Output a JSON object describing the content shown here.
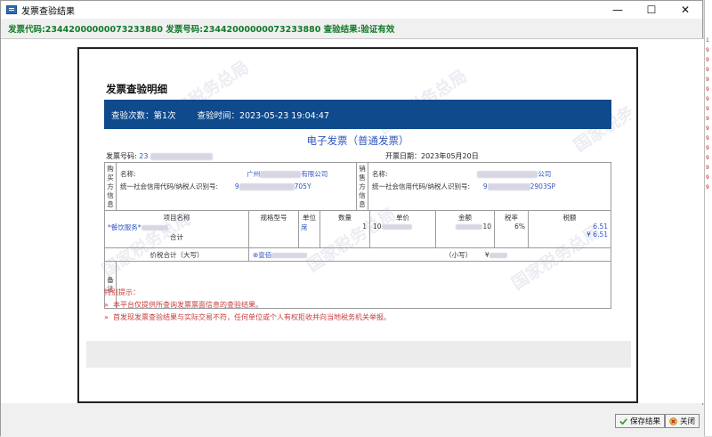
{
  "window": {
    "title": "发票查验结果",
    "minimize": "—",
    "maximize": "☐",
    "close": "✕"
  },
  "status_line": "发票代码:23442000000073233880 发票号码:23442000000073233880 查验结果:验证有效",
  "doc": {
    "heading": "发票查验明细",
    "check_count": "查验次数：第1次",
    "check_time": "查验时间：2023-05-23 19:04:47",
    "invoice_title": "电子发票（普通发票）",
    "invoice_no_label": "发票号码:",
    "invoice_no_value": "23",
    "issue_date": "开票日期：2023年05月20日",
    "buyer": {
      "v_label": [
        "购",
        "买",
        "方",
        "信",
        "息"
      ],
      "name_label": "名称:",
      "name_value": "广州",
      "name_suffix": "有限公司",
      "id_label": "统一社会信用代码/纳税人识别号:",
      "id_prefix": "9",
      "id_suffix": "705Y"
    },
    "seller": {
      "v_label": [
        "销",
        "售",
        "方",
        "信",
        "息"
      ],
      "name_label": "名称:",
      "name_suffix": "公司",
      "id_label": "统一社会信用代码/纳税人识别号:",
      "id_prefix": "9",
      "id_suffix": "2903SP"
    },
    "items_head": {
      "name": "项目名称",
      "spec": "规格型号",
      "unit": "单位",
      "qty": "数量",
      "price": "单价",
      "amount": "金额",
      "rate": "税率",
      "tax": "税额"
    },
    "item": {
      "name": "*餐饮服务*",
      "unit": "席",
      "qty": "1",
      "price": "10",
      "amount_suffix": "10",
      "rate": "6%",
      "tax": "6.51"
    },
    "subtotal_label": "合计",
    "subtotal_tax": "¥ 6.51",
    "total_label": "价税合计（大写）",
    "total_upper_prefix": "⊗壹佰",
    "total_small_label": "（小写）",
    "total_small_value": "¥",
    "remarks_label": [
      "备",
      "注"
    ]
  },
  "notice": {
    "title": "特别提示：",
    "items": [
      "本平台仅提供所查询发票票面信息的查验结果。",
      "首发现发票查验结果与实际交易不符，任何单位或个人有权拒收并向当地税务机关举报。"
    ]
  },
  "watermark": "国家税务总局",
  "buttons": {
    "save": "保存结果",
    "close": "关闭"
  },
  "right_strip": [
    "1",
    "9",
    "9",
    "9",
    "9",
    "9",
    "9",
    "9",
    "9",
    "9",
    "9",
    "9",
    "9",
    "9",
    "9",
    "9"
  ],
  "colors": {
    "status_green": "#127a2a",
    "header_blue": "#0e4a8c",
    "link_blue": "#2f56c0",
    "notice_red": "#c83c3c"
  }
}
